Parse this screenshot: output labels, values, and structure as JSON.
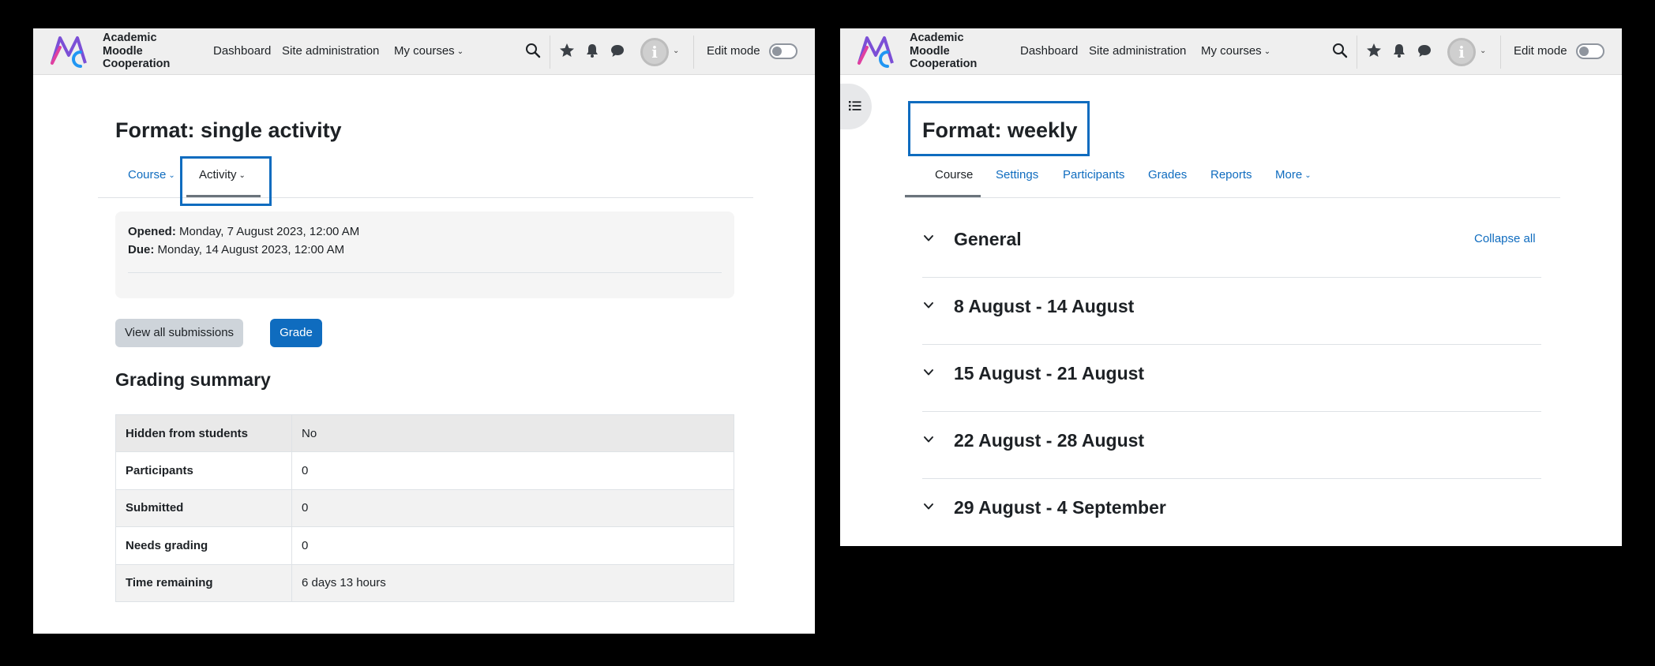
{
  "brand": {
    "line1": "Academic",
    "line2": "Moodle",
    "line3": "Cooperation",
    "colors": {
      "purple": "#7b4fd6",
      "blue": "#2196f3",
      "pink": "#e040a0",
      "accent": "#0f6cbf"
    }
  },
  "nav": {
    "dashboard": "Dashboard",
    "site_admin": "Site administration",
    "my_courses": "My courses",
    "edit_mode": "Edit mode",
    "icons": [
      "search-icon",
      "star-icon",
      "bell-icon",
      "chat-icon",
      "user-avatar-icon",
      "chevron-down-icon"
    ]
  },
  "left": {
    "title": "Format: single activity",
    "tabs": {
      "course": "Course",
      "activity": "Activity"
    },
    "dates": {
      "opened_label": "Opened:",
      "opened_value": "Monday, 7 August 2023, 12:00 AM",
      "due_label": "Due:",
      "due_value": "Monday, 14 August 2023, 12:00 AM"
    },
    "buttons": {
      "view_all": "View all submissions",
      "grade": "Grade"
    },
    "summary_title": "Grading summary",
    "summary_rows": [
      {
        "label": "Hidden from students",
        "value": "No"
      },
      {
        "label": "Participants",
        "value": "0"
      },
      {
        "label": "Submitted",
        "value": "0"
      },
      {
        "label": "Needs grading",
        "value": "0"
      },
      {
        "label": "Time remaining",
        "value": "6 days 13 hours"
      }
    ]
  },
  "right": {
    "title": "Format: weekly",
    "tabs": {
      "course": "Course",
      "settings": "Settings",
      "participants": "Participants",
      "grades": "Grades",
      "reports": "Reports",
      "more": "More"
    },
    "collapse_all": "Collapse all",
    "sections": [
      "General",
      "8 August - 14 August",
      "15 August - 21 August",
      "22 August - 28 August",
      "29 August - 4 September"
    ]
  }
}
